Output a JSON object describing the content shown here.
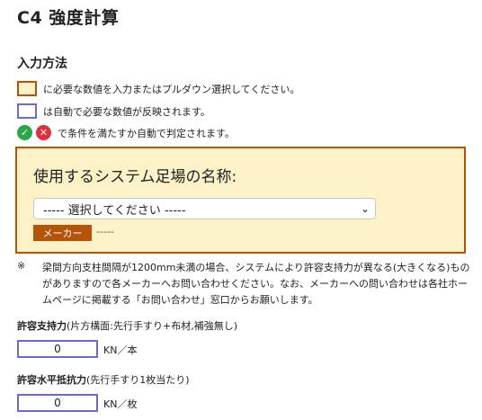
{
  "page_title": "C4 強度計算",
  "section_title": "入力方法",
  "legend": {
    "input_text": "に必要な数値を入力またはプルダウン選択してください。",
    "auto_text": "は自動で必要な数値が反映されます。",
    "judge_text": "で条件を満たすか自動で判定されます。",
    "ok_icon": "check-icon",
    "ng_icon": "cross-icon"
  },
  "colors": {
    "input_border": "#b45309",
    "input_bg": "#fdf1c7",
    "auto_border": "#6a6ad4",
    "ok": "#2aa745",
    "ng": "#e0303a"
  },
  "system_panel": {
    "title": "使用するシステム足場の名称:",
    "select_value": "----- 選択してください -----",
    "maker_label": "メーカー",
    "maker_value": "-----"
  },
  "note": {
    "mark": "※",
    "text": "梁間方向支柱間隔が1200mm未満の場合、システムにより許容支持力が異なる(大きくなる)ものがありますので各メーカーへお問い合わせください。なお、メーカーへの問い合わせは各社ホームページに掲載する「お問い合わせ」窓口からお願いします。"
  },
  "fields": [
    {
      "label": "許容支持力",
      "sub": "(片方構面:先行手すり+布材,補強無し)",
      "value": "0",
      "unit": "KN／本"
    },
    {
      "label": "許容水平抵抗力",
      "sub": "(先行手すり1枚当たり)",
      "value": "0",
      "unit": "KN／枚"
    }
  ]
}
